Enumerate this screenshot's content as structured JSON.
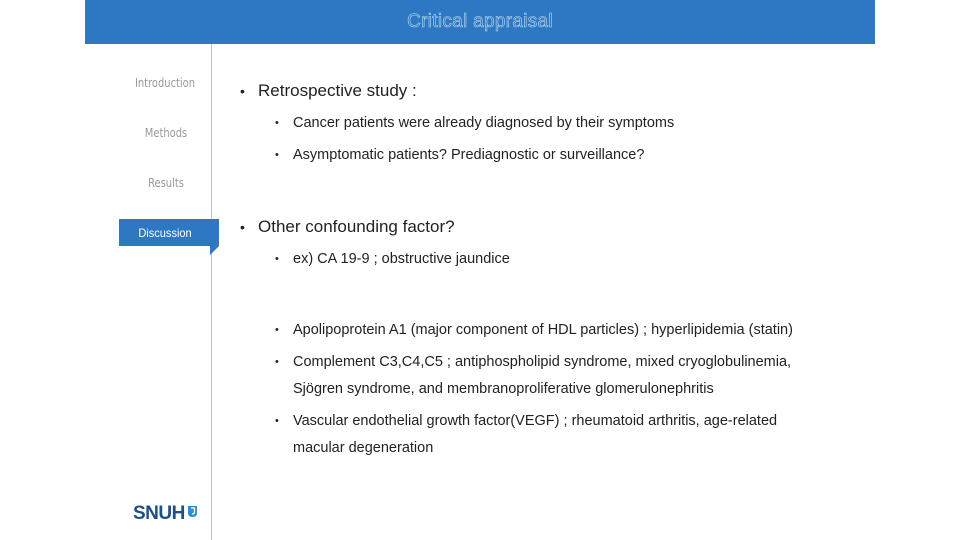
{
  "header": {
    "title": "Critical appraisal"
  },
  "nav": {
    "items": [
      {
        "label": "Introduction",
        "active": false
      },
      {
        "label": "Methods",
        "active": false
      },
      {
        "label": "Results",
        "active": false
      },
      {
        "label": "Discussion",
        "active": true
      }
    ]
  },
  "content": {
    "sections": [
      {
        "bullet": "•",
        "heading": "Retrospective study :",
        "items": [
          {
            "bullet": "•",
            "text": "Cancer patients were already diagnosed by their symptoms"
          },
          {
            "bullet": "•",
            "text": "Asymptomatic patients? Prediagnostic or surveillance?"
          }
        ]
      },
      {
        "bullet": "•",
        "heading": "Other confounding factor?",
        "items": [
          {
            "bullet": "•",
            "text": "ex) CA 19-9 ; obstructive jaundice"
          },
          {
            "bullet": "•",
            "text": "Apolipoprotein A1 (major component of HDL particles) ; hyperlipidemia (statin)"
          },
          {
            "bullet": "•",
            "text": "Complement C3,C4,C5 ; antiphospholipid syndrome, mixed cryoglobulinemia,",
            "text_cont": "Sjögren syndrome, and membranoproliferative glomerulonephritis"
          },
          {
            "bullet": "•",
            "text": "Vascular endothelial growth factor(VEGF) ; rheumatoid arthritis, age-related",
            "text_cont": "macular degeneration"
          }
        ]
      }
    ]
  },
  "logo": {
    "text": "SNUH",
    "icon": "snuh-mark-icon"
  },
  "colors": {
    "accent": "#2E78C3",
    "nav_inactive": "#9a9a9a",
    "body_text": "#222222",
    "logo_text": "#1f4e85",
    "logo_mark": "#2a8fd0"
  }
}
